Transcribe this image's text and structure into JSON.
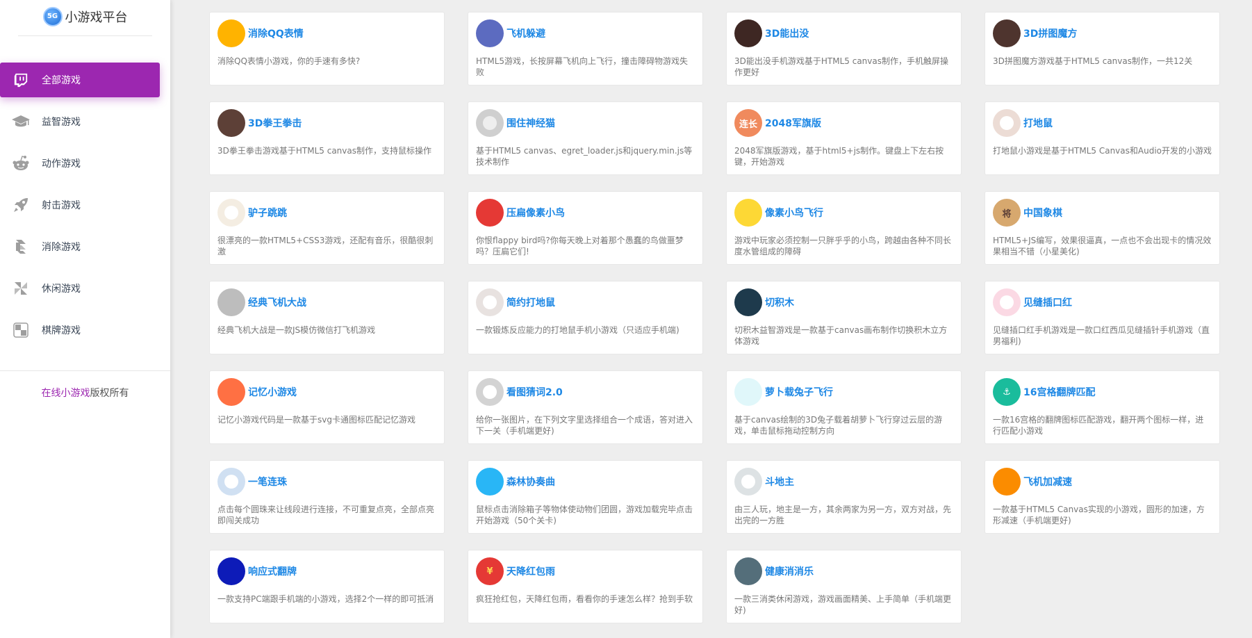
{
  "logo": {
    "badge": "5G",
    "title": "小游戏平台"
  },
  "nav": [
    {
      "label": "全部游戏",
      "icon": "twitch-icon",
      "active": true
    },
    {
      "label": "益智游戏",
      "icon": "graduation-cap-icon",
      "active": false
    },
    {
      "label": "动作游戏",
      "icon": "reddit-icon",
      "active": false
    },
    {
      "label": "射击游戏",
      "icon": "rocket-icon",
      "active": false
    },
    {
      "label": "消除游戏",
      "icon": "blocks-icon",
      "active": false
    },
    {
      "label": "休闲游戏",
      "icon": "pinwheel-icon",
      "active": false
    },
    {
      "label": "棋牌游戏",
      "icon": "checker-squares-icon",
      "active": false
    }
  ],
  "copyright": {
    "brand": "在线小游戏",
    "suffix": "版权所有"
  },
  "games": [
    {
      "title": "消除QQ表情",
      "desc": "消除QQ表情小游戏，你的手速有多快?",
      "thumb": {
        "bg": "#ffb300",
        "fg": "#e53935",
        "glyph": ""
      }
    },
    {
      "title": "飞机躲避",
      "desc": "HTML5游戏，长按屏幕飞机向上飞行，撞击障碍物游戏失败",
      "thumb": {
        "bg": "#5c6bc0",
        "fg": "#ffffff",
        "glyph": ""
      }
    },
    {
      "title": "3D能出没",
      "desc": "3D能出没手机游戏基于HTML5 canvas制作，手机触屏操作更好",
      "thumb": {
        "bg": "#3e2723",
        "fg": "#ffffff",
        "glyph": ""
      }
    },
    {
      "title": "3D拼图魔方",
      "desc": "3D拼图魔方游戏基于HTML5 canvas制作，一共12关",
      "thumb": {
        "bg": "#4e342e",
        "fg": "#ffffff",
        "glyph": ""
      }
    },
    {
      "title": "3D拳王拳击",
      "desc": "3D拳王拳击游戏基于HTML5 canvas制作，支持鼠标操作",
      "thumb": {
        "bg": "#5d4037",
        "fg": "#ffffff",
        "glyph": ""
      }
    },
    {
      "title": "围住神经猫",
      "desc": "基于HTML5 canvas、egret_loader.js和jquery.min.js等技术制作",
      "thumb": {
        "bg": "#eeeeee",
        "fg": "#555555",
        "glyph": ""
      }
    },
    {
      "title": "2048军旗版",
      "desc": "2048军旗版游戏，基于html5+js制作。键盘上下左右按键，开始游戏",
      "thumb": {
        "bg": "#f08a5d",
        "fg": "#ffffff",
        "glyph": "连长"
      }
    },
    {
      "title": "打地鼠",
      "desc": "打地鼠小游戏是基于HTML5 Canvas和Audio开发的小游戏",
      "thumb": {
        "bg": "#ffffff",
        "fg": "#a0522d",
        "glyph": ""
      }
    },
    {
      "title": "驴子跳跳",
      "desc": "很漂亮的一款HTML5+CSS3游戏，还配有音乐，很酷很刺激",
      "thumb": {
        "bg": "#ffffff",
        "fg": "#c8a46e",
        "glyph": ""
      }
    },
    {
      "title": "压扁像素小鸟",
      "desc": "你恨flappy bird吗?你每天晚上对着那个愚蠢的鸟做噩梦吗？压扁它们!",
      "thumb": {
        "bg": "#e53935",
        "fg": "#ffffff",
        "glyph": ""
      }
    },
    {
      "title": "像素小鸟飞行",
      "desc": "游戏中玩家必须控制一只胖乎乎的小鸟，跨越由各种不同长度水管组成的障碍",
      "thumb": {
        "bg": "#fdd835",
        "fg": "#333333",
        "glyph": ""
      }
    },
    {
      "title": "中国象棋",
      "desc": "HTML5+JS编写，效果很逼真，一点也不会出现卡的情况效果相当不错（小星美化)",
      "thumb": {
        "bg": "#d7a86e",
        "fg": "#5d4037",
        "glyph": "将"
      }
    },
    {
      "title": "经典飞机大战",
      "desc": "经典飞机大战是一款JS模仿微信打飞机游戏",
      "thumb": {
        "bg": "#bdbdbd",
        "fg": "#424242",
        "glyph": ""
      }
    },
    {
      "title": "简约打地鼠",
      "desc": "一款锻炼反应能力的打地鼠手机小游戏（只适应手机端)",
      "thumb": {
        "bg": "#ffffff",
        "fg": "#8d6e63",
        "glyph": ""
      }
    },
    {
      "title": "切积木",
      "desc": "切积木益智游戏是一款基于canvas画布制作切换积木立方体游戏",
      "thumb": {
        "bg": "#1e3a4c",
        "fg": "#ffffff",
        "glyph": ""
      }
    },
    {
      "title": "见缝插口红",
      "desc": "见缝插口红手机游戏是一款口红西瓜见缝插针手机游戏（直男福利)",
      "thumb": {
        "bg": "#ffffff",
        "fg": "#ec407a",
        "glyph": ""
      }
    },
    {
      "title": "记忆小游戏",
      "desc": "记忆小游戏代码是一款基于svg卡通图标匹配记忆游戏",
      "thumb": {
        "bg": "#ff7043",
        "fg": "#ffffff",
        "glyph": ""
      }
    },
    {
      "title": "看图猜词2.0",
      "desc": "给你一张图片，在下列文字里选择组合一个成语，答对进入下一关（手机端更好)",
      "thumb": {
        "bg": "#ffffff",
        "fg": "#212121",
        "glyph": ""
      }
    },
    {
      "title": "萝卜载兔子飞行",
      "desc": "基于canvas绘制的3D兔子载着胡萝卜飞行穿过云层的游戏，单击鼠标拖动控制方向",
      "thumb": {
        "bg": "#e0f7fa",
        "fg": "#ffffff",
        "glyph": ""
      }
    },
    {
      "title": "16宫格翻牌匹配",
      "desc": "一款16宫格的翻牌图标匹配游戏，翻开两个图标一样，进行匹配小游戏",
      "thumb": {
        "bg": "#1abc9c",
        "fg": "#ffffff",
        "glyph": "⚓"
      }
    },
    {
      "title": "一笔连珠",
      "desc": "点击每个圆珠来让线段进行连接，不可重复点亮，全部点亮即闯关成功",
      "thumb": {
        "bg": "#ffffff",
        "fg": "#1565c0",
        "glyph": ""
      }
    },
    {
      "title": "森林协奏曲",
      "desc": "鼠标点击消除箱子等物体使动物们团圆，游戏加载完毕点击开始游戏（50个关卡)",
      "thumb": {
        "bg": "#29b6f6",
        "fg": "#ffffff",
        "glyph": ""
      }
    },
    {
      "title": "斗地主",
      "desc": "由三人玩，地主是一方，其余两家为另一方，双方对战，先出完的一方胜",
      "thumb": {
        "bg": "#ffffff",
        "fg": "#546e7a",
        "glyph": ""
      }
    },
    {
      "title": "飞机加减速",
      "desc": "一款基于HTML5 Canvas实现的小游戏，圆形的加速，方形减速（手机端更好)",
      "thumb": {
        "bg": "#fb8c00",
        "fg": "#212121",
        "glyph": ""
      }
    },
    {
      "title": "响应式翻牌",
      "desc": "一款支持PC端跟手机端的小游戏，选择2个一样的即可抵消",
      "thumb": {
        "bg": "#0d1bb8",
        "fg": "#ffffff",
        "glyph": ""
      }
    },
    {
      "title": "天降红包雨",
      "desc": "疯狂抢红包，天降红包雨，看看你的手速怎么样？抢到手软",
      "thumb": {
        "bg": "#e53935",
        "fg": "#ffd54f",
        "glyph": "¥"
      }
    },
    {
      "title": "健康消消乐",
      "desc": "一款三消类休闲游戏，游戏画面精美、上手简单（手机端更好)",
      "thumb": {
        "bg": "#546e7a",
        "fg": "#ffffff",
        "glyph": ""
      }
    }
  ]
}
